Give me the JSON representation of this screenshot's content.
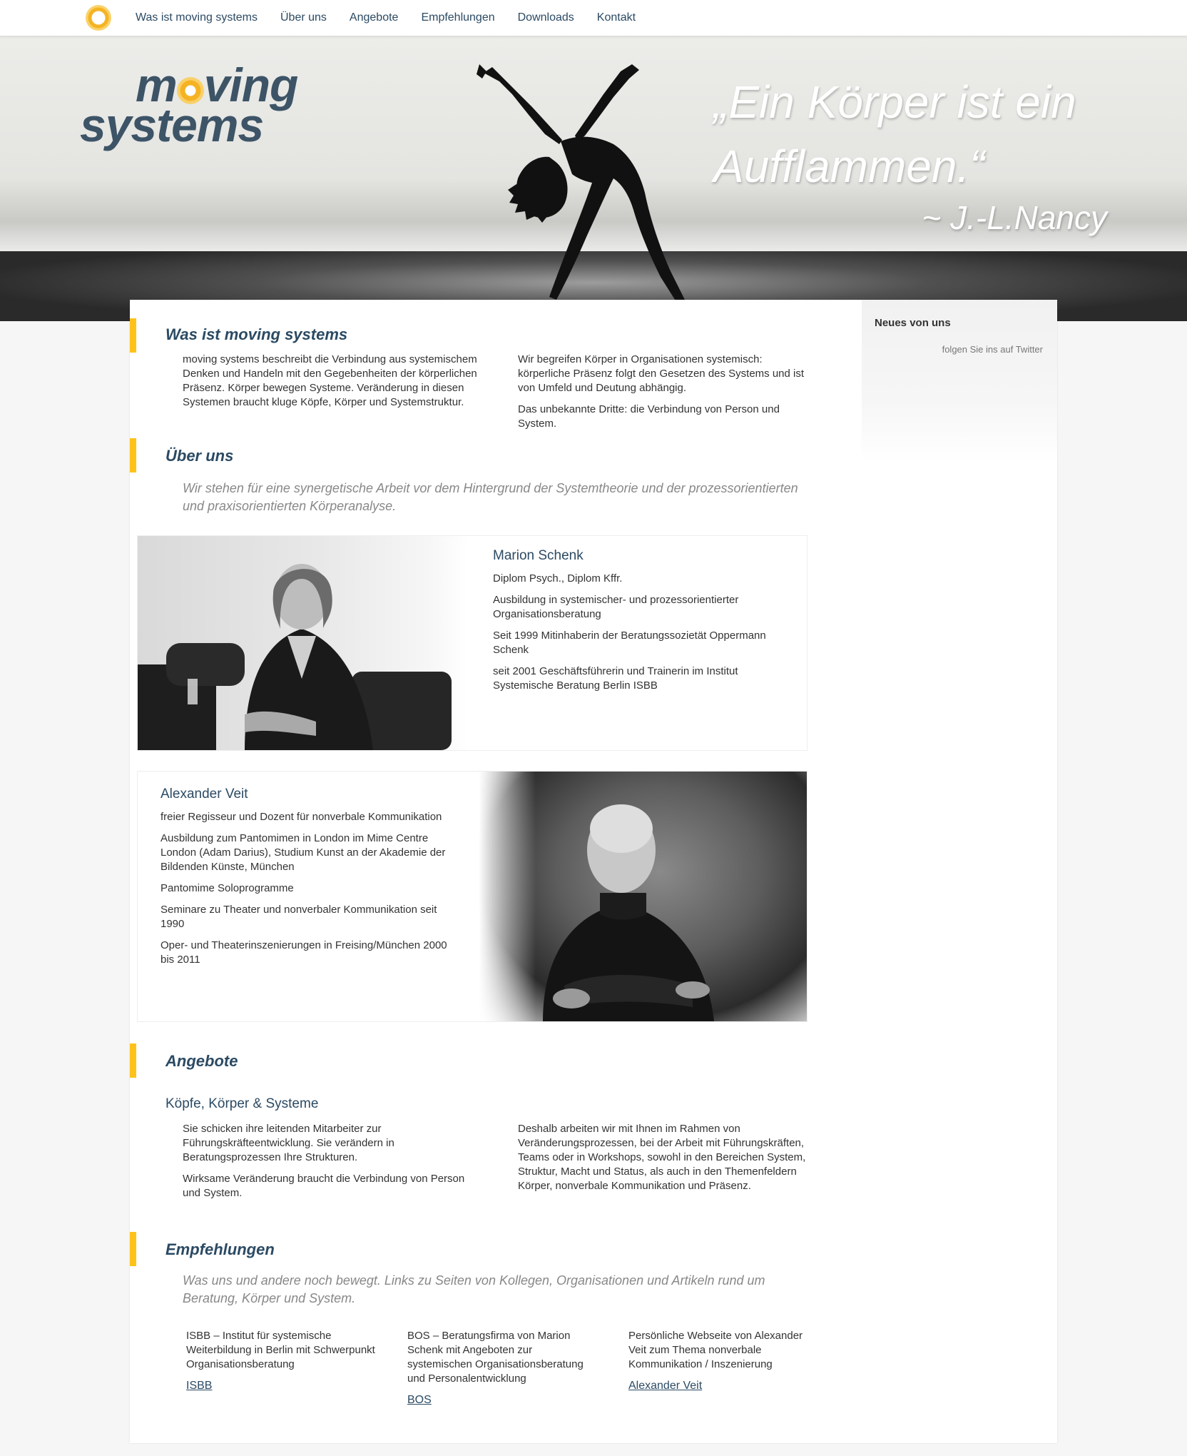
{
  "nav": {
    "items": [
      "Was ist moving systems",
      "Über uns",
      "Angebote",
      "Empfehlungen",
      "Downloads",
      "Kontakt"
    ]
  },
  "hero": {
    "brand_line1_pre": "m",
    "brand_line1_post": "ving",
    "brand_line2": "systems",
    "quote_line1": "„Ein Körper ist ein",
    "quote_line2": "Aufflammen.“",
    "quote_author": "~ J.-L.Nancy"
  },
  "sidebar": {
    "title": "Neues von uns",
    "twitter_link": "folgen Sie ins auf Twitter"
  },
  "was_ist": {
    "title": "Was ist moving systems",
    "col1": "moving systems beschreibt die Verbindung aus systemischem Denken und Handeln mit den Gegebenheiten der körperlichen Präsenz. Körper bewegen Systeme. Veränderung in diesen Systemen braucht kluge Köpfe, Körper und Systemstruktur.",
    "col2_p1": "Wir begreifen Körper in Organisationen systemisch: körperliche Präsenz folgt den Gesetzen des Systems und ist von Umfeld und Deutung abhängig.",
    "col2_p2": "Das unbekannte Dritte: die Verbindung von Person und System."
  },
  "ueber": {
    "title": "Über uns",
    "lead": "Wir stehen für eine synergetische Arbeit vor dem Hintergrund der Systemtheorie und der prozessorientierten und praxisorientierten Körperanalyse."
  },
  "marion": {
    "name": "Marion Schenk",
    "lines": [
      "Diplom Psych., Diplom Kffr.",
      "Ausbildung in systemischer- und prozessorientierter Organisationsberatung",
      "Seit 1999 Mitinhaberin der Beratungssozietät Oppermann Schenk",
      "seit 2001 Geschäftsführerin und Trainerin im Institut Systemische Beratung Berlin ISBB"
    ]
  },
  "alexander": {
    "name": "Alexander Veit",
    "lines": [
      "freier Regisseur und Dozent für nonverbale Kommunikation",
      "Ausbildung zum Pantomimen in London im Mime Centre London (Adam Darius), Studium Kunst an der Akademie der Bildenden Künste, München",
      "Pantomime Soloprogramme",
      "Seminare zu Theater und nonverbaler Kommunikation seit 1990",
      "Oper- und Theaterinszenierungen in Freising/München 2000 bis 2011"
    ]
  },
  "angebote": {
    "title": "Angebote",
    "subtitle": "Köpfe, Körper & Systeme",
    "col1_p1": "Sie schicken ihre leitenden Mitarbeiter zur Führungskräfteentwicklung. Sie verändern in Beratungsprozessen Ihre Strukturen.",
    "col1_p2": "Wirksame Veränderung braucht die Verbindung von Person und System.",
    "col2": "Deshalb arbeiten wir mit Ihnen im Rahmen von Veränderungsprozessen, bei der Arbeit mit Führungskräften, Teams oder in Workshops, sowohl in den Bereichen System, Struktur, Macht und Status, als auch in den Themenfeldern Körper, nonverbale Kommunikation und Präsenz."
  },
  "empfehlungen": {
    "title": "Empfehlungen",
    "lead": "Was uns und andere noch bewegt. Links zu Seiten von Kollegen, Organisationen und Artikeln rund um Beratung, Körper und System.",
    "items": [
      {
        "text": "ISBB – Institut für systemische Weiterbildung in Berlin mit Schwerpunkt Organisationsberatung",
        "link": "ISBB"
      },
      {
        "text": "BOS – Beratungsfirma von Marion Schenk mit Angeboten zur systemischen Organisationsberatung und Personalentwicklung",
        "link": "BOS"
      },
      {
        "text": "Persönliche Webseite von Alexander Veit zum Thema nonverbale Kommunikation / Inszenierung",
        "link": "Alexander Veit"
      }
    ]
  },
  "colors": {
    "accent": "#ffc21a",
    "heading": "#2b4a63",
    "brand": "#3d5467"
  }
}
